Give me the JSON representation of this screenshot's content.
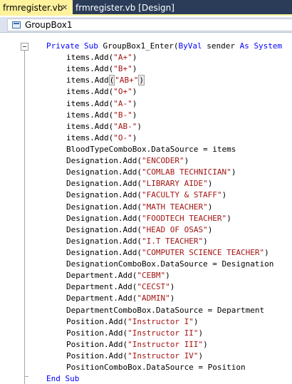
{
  "tabs": [
    {
      "label": "frmregister.vb",
      "active": true,
      "close_glyph": "✕"
    },
    {
      "label": "frmregister.vb [Design]",
      "active": false
    }
  ],
  "navbar": {
    "member": "GroupBox1",
    "icon": "groupbox-icon"
  },
  "colors": {
    "keyword": "#0000ff",
    "string": "#a31515",
    "tab_active": "#fff29d",
    "tab_strip": "#2b3c59"
  },
  "code": [
    {
      "indent": 0,
      "tokens": [
        {
          "t": "kw",
          "v": "Private"
        },
        {
          "t": "",
          "v": " "
        },
        {
          "t": "kw",
          "v": "Sub"
        },
        {
          "t": "",
          "v": " GroupBox1_Enter("
        },
        {
          "t": "kw",
          "v": "ByVal"
        },
        {
          "t": "",
          "v": " sender "
        },
        {
          "t": "kw",
          "v": "As"
        },
        {
          "t": "",
          "v": " "
        },
        {
          "t": "kw",
          "v": "System"
        }
      ]
    },
    {
      "indent": 1,
      "tokens": [
        {
          "t": "",
          "v": "items.Add("
        },
        {
          "t": "str",
          "v": "\"A+\""
        },
        {
          "t": "",
          "v": ")"
        }
      ]
    },
    {
      "indent": 1,
      "tokens": [
        {
          "t": "",
          "v": "items.Add("
        },
        {
          "t": "str",
          "v": "\"B+\""
        },
        {
          "t": "",
          "v": ")"
        }
      ]
    },
    {
      "indent": 1,
      "tokens": [
        {
          "t": "",
          "v": "items.Add"
        },
        {
          "t": "hl",
          "v": "("
        },
        {
          "t": "str",
          "v": "\"AB+\""
        },
        {
          "t": "hl",
          "v": ")"
        }
      ]
    },
    {
      "indent": 1,
      "tokens": [
        {
          "t": "",
          "v": "items.Add("
        },
        {
          "t": "str",
          "v": "\"O+\""
        },
        {
          "t": "",
          "v": ")"
        }
      ]
    },
    {
      "indent": 1,
      "tokens": [
        {
          "t": "",
          "v": "items.Add("
        },
        {
          "t": "str",
          "v": "\"A-\""
        },
        {
          "t": "",
          "v": ")"
        }
      ]
    },
    {
      "indent": 1,
      "tokens": [
        {
          "t": "",
          "v": "items.Add("
        },
        {
          "t": "str",
          "v": "\"B-\""
        },
        {
          "t": "",
          "v": ")"
        }
      ]
    },
    {
      "indent": 1,
      "tokens": [
        {
          "t": "",
          "v": "items.Add("
        },
        {
          "t": "str",
          "v": "\"AB-\""
        },
        {
          "t": "",
          "v": ")"
        }
      ]
    },
    {
      "indent": 1,
      "tokens": [
        {
          "t": "",
          "v": "items.Add("
        },
        {
          "t": "str",
          "v": "\"O-\""
        },
        {
          "t": "",
          "v": ")"
        }
      ]
    },
    {
      "indent": 1,
      "tokens": [
        {
          "t": "",
          "v": "BloodTypeComboBox.DataSource = items"
        }
      ]
    },
    {
      "indent": 1,
      "tokens": [
        {
          "t": "",
          "v": "Designation.Add("
        },
        {
          "t": "str",
          "v": "\"ENCODER\""
        },
        {
          "t": "",
          "v": ")"
        }
      ]
    },
    {
      "indent": 1,
      "tokens": [
        {
          "t": "",
          "v": "Designation.Add("
        },
        {
          "t": "str",
          "v": "\"COMLAB TECHNICIAN\""
        },
        {
          "t": "",
          "v": ")"
        }
      ]
    },
    {
      "indent": 1,
      "tokens": [
        {
          "t": "",
          "v": "Designation.Add("
        },
        {
          "t": "str",
          "v": "\"LIBRARY AIDE\""
        },
        {
          "t": "",
          "v": ")"
        }
      ]
    },
    {
      "indent": 1,
      "tokens": [
        {
          "t": "",
          "v": "Designation.Add("
        },
        {
          "t": "str",
          "v": "\"FACULTY & STAFF\""
        },
        {
          "t": "",
          "v": ")"
        }
      ]
    },
    {
      "indent": 1,
      "tokens": [
        {
          "t": "",
          "v": "Designation.Add("
        },
        {
          "t": "str",
          "v": "\"MATH TEACHER\""
        },
        {
          "t": "",
          "v": ")"
        }
      ]
    },
    {
      "indent": 1,
      "tokens": [
        {
          "t": "",
          "v": "Designation.Add("
        },
        {
          "t": "str",
          "v": "\"FOODTECH TEACHER\""
        },
        {
          "t": "",
          "v": ")"
        }
      ]
    },
    {
      "indent": 1,
      "tokens": [
        {
          "t": "",
          "v": "Designation.Add("
        },
        {
          "t": "str",
          "v": "\"HEAD OF OSAS\""
        },
        {
          "t": "",
          "v": ")"
        }
      ]
    },
    {
      "indent": 1,
      "tokens": [
        {
          "t": "",
          "v": "Designation.Add("
        },
        {
          "t": "str",
          "v": "\"I.T TEACHER\""
        },
        {
          "t": "",
          "v": ")"
        }
      ]
    },
    {
      "indent": 1,
      "tokens": [
        {
          "t": "",
          "v": "Designation.Add("
        },
        {
          "t": "str",
          "v": "\"COMPUTER SCIENCE TEACHER\""
        },
        {
          "t": "",
          "v": ")"
        }
      ]
    },
    {
      "indent": 1,
      "tokens": [
        {
          "t": "",
          "v": "DesignationComboBox.DataSource = Designation"
        }
      ]
    },
    {
      "indent": 1,
      "tokens": [
        {
          "t": "",
          "v": "Department.Add("
        },
        {
          "t": "str",
          "v": "\"CEBM\""
        },
        {
          "t": "",
          "v": ")"
        }
      ]
    },
    {
      "indent": 1,
      "tokens": [
        {
          "t": "",
          "v": "Department.Add("
        },
        {
          "t": "str",
          "v": "\"CECST\""
        },
        {
          "t": "",
          "v": ")"
        }
      ]
    },
    {
      "indent": 1,
      "tokens": [
        {
          "t": "",
          "v": "Department.Add("
        },
        {
          "t": "str",
          "v": "\"ADMIN\""
        },
        {
          "t": "",
          "v": ")"
        }
      ]
    },
    {
      "indent": 1,
      "tokens": [
        {
          "t": "",
          "v": "DepartmentComboBox.DataSource = Department"
        }
      ]
    },
    {
      "indent": 1,
      "tokens": [
        {
          "t": "",
          "v": "Position.Add("
        },
        {
          "t": "str",
          "v": "\"Instructor I\""
        },
        {
          "t": "",
          "v": ")"
        }
      ]
    },
    {
      "indent": 1,
      "tokens": [
        {
          "t": "",
          "v": "Position.Add("
        },
        {
          "t": "str",
          "v": "\"Instructor II\""
        },
        {
          "t": "",
          "v": ")"
        }
      ]
    },
    {
      "indent": 1,
      "tokens": [
        {
          "t": "",
          "v": "Position.Add("
        },
        {
          "t": "str",
          "v": "\"Instructor III\""
        },
        {
          "t": "",
          "v": ")"
        }
      ]
    },
    {
      "indent": 1,
      "tokens": [
        {
          "t": "",
          "v": "Position.Add("
        },
        {
          "t": "str",
          "v": "\"Instructor IV\""
        },
        {
          "t": "",
          "v": ")"
        }
      ]
    },
    {
      "indent": 1,
      "tokens": [
        {
          "t": "",
          "v": "PositionComboBox.DataSource = Position"
        }
      ]
    },
    {
      "indent": 0,
      "tokens": [
        {
          "t": "kw",
          "v": "End"
        },
        {
          "t": "",
          "v": " "
        },
        {
          "t": "kw",
          "v": "Sub"
        }
      ]
    }
  ]
}
